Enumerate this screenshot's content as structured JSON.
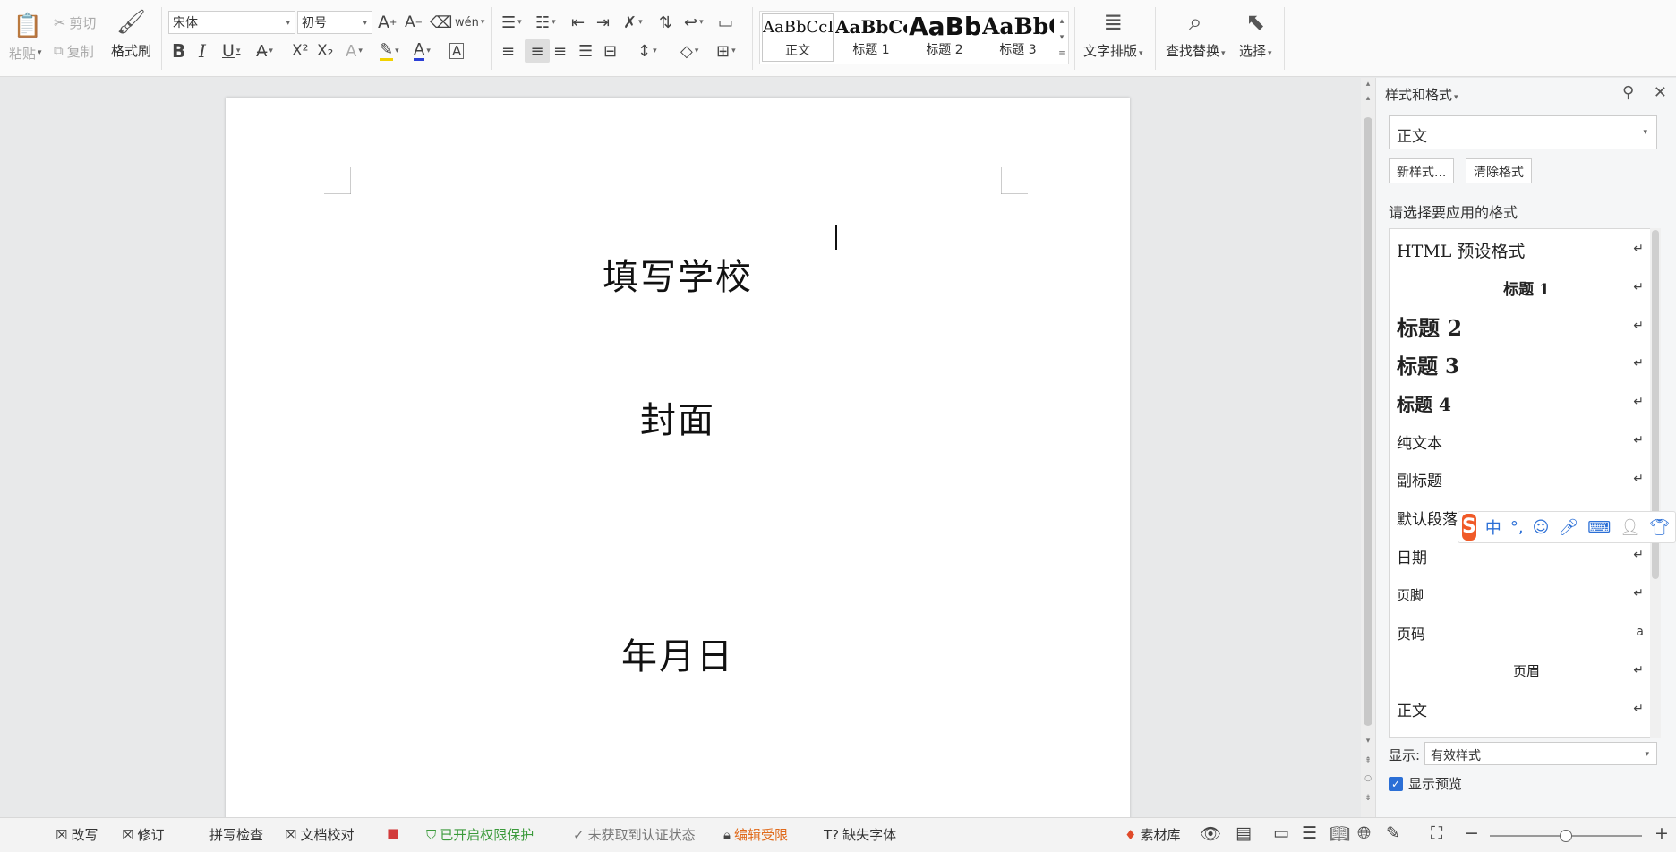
{
  "ribbon": {
    "clipboard": {
      "paste": "粘贴",
      "cut": "剪切",
      "copy": "复制",
      "format_painter": "格式刷"
    },
    "font": {
      "name": "宋体",
      "size": "初号",
      "bold": "B",
      "italic": "I",
      "underline": "U",
      "superscript": "X²",
      "subscript": "X₂",
      "grow": "A",
      "shrink": "A",
      "pinyin": "wén",
      "font_color": "A",
      "border_char": "A"
    },
    "styles": [
      {
        "sample": "AaBbCcDd",
        "name": "正文",
        "size": 18,
        "weight": "normal"
      },
      {
        "sample": "AaBbCcI",
        "name": "标题 1",
        "size": 20,
        "weight": "bold"
      },
      {
        "sample": "AaBb(",
        "name": "标题 2",
        "size": 28,
        "weight": "bold"
      },
      {
        "sample": "AaBbC",
        "name": "标题 3",
        "size": 25,
        "weight": "bold"
      }
    ],
    "text_layout": "文字排版",
    "find_replace": "查找替换",
    "select": "选择"
  },
  "document": {
    "line1": "填写学校",
    "line2": "封面",
    "line3": "年月日"
  },
  "style_pane": {
    "title": "样式和格式",
    "current_style": "正文",
    "new_style_button": "新样式...",
    "clear_format_button": "清除格式",
    "choose_label": "请选择要应用的格式",
    "items": [
      {
        "label": "HTML  预设格式",
        "size": 19,
        "weight": "normal",
        "align": "left",
        "mark": "↵"
      },
      {
        "label": "标题  1",
        "size": 17,
        "weight": "bold",
        "align": "center",
        "mark": "↵"
      },
      {
        "label": "标题  2",
        "size": 24,
        "weight": "bold",
        "align": "left",
        "mark": "↵"
      },
      {
        "label": "标题  3",
        "size": 23,
        "weight": "bold",
        "align": "left",
        "mark": "↵"
      },
      {
        "label": "标题  4",
        "size": 20,
        "weight": "bold",
        "align": "left",
        "mark": "↵"
      },
      {
        "label": "纯文本",
        "size": 17,
        "weight": "normal",
        "align": "left",
        "mark": "↵"
      },
      {
        "label": "副标题",
        "size": 17,
        "weight": "normal",
        "align": "left",
        "mark": "↵"
      },
      {
        "label": "默认段落字体",
        "size": 17,
        "weight": "normal",
        "align": "left",
        "mark": ""
      },
      {
        "label": "日期",
        "size": 17,
        "weight": "normal",
        "align": "left",
        "mark": "↵"
      },
      {
        "label": "页脚",
        "size": 15,
        "weight": "normal",
        "align": "left",
        "mark": "↵"
      },
      {
        "label": "页码",
        "size": 16,
        "weight": "normal",
        "align": "left",
        "mark": "a"
      },
      {
        "label": "页眉",
        "size": 15,
        "weight": "normal",
        "align": "center",
        "mark": "↵"
      },
      {
        "label": "正文",
        "size": 17,
        "weight": "normal",
        "align": "left",
        "mark": "↵"
      }
    ],
    "show_label": "显示:",
    "show_value": "有效样式",
    "preview_label": "显示预览"
  },
  "ime": {
    "logo": "S",
    "mode": "中"
  },
  "status": {
    "overwrite": "改写",
    "revise": "修订",
    "spell_check": "拼写检查",
    "proofread": "文档校对",
    "protection": "已开启权限保护",
    "cert": "未获取到认证状态",
    "edit_limited": "编辑受限",
    "missing_font": "缺失字体",
    "material": "素材库"
  },
  "colors": {
    "accent": "#2b6fd6",
    "protect_green": "#3b9a3b",
    "limit_orange": "#e06a1b",
    "ime_orange": "#f05a28"
  }
}
